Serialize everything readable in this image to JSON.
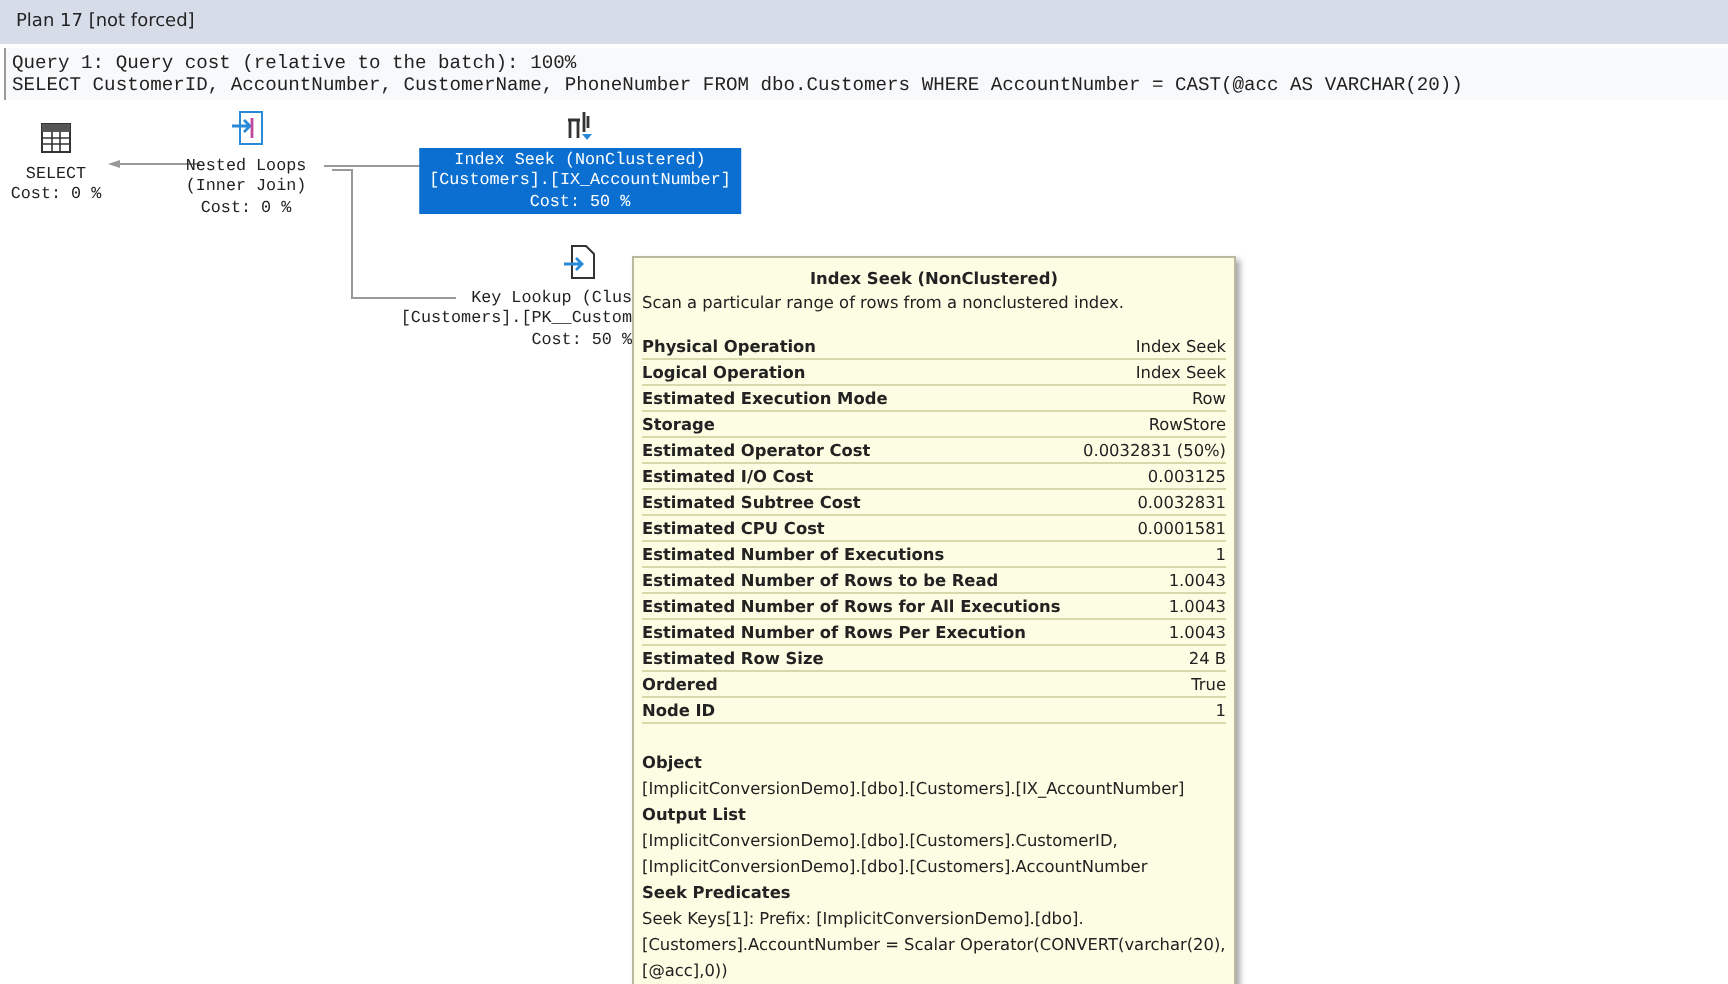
{
  "plan_title": "Plan 17 [not forced]",
  "query": {
    "header": "Query 1: Query cost (relative to the batch): 100%",
    "sql": "SELECT CustomerID, AccountNumber, CustomerName, PhoneNumber FROM dbo.Customers WHERE AccountNumber = CAST(@acc AS VARCHAR(20))"
  },
  "nodes": [
    {
      "kind": "select",
      "lines": [
        "SELECT",
        "Cost: 0 %"
      ],
      "selected": false
    },
    {
      "kind": "nested-loops",
      "lines": [
        "Nested Loops",
        "(Inner Join)",
        "Cost: 0 %"
      ],
      "selected": false
    },
    {
      "kind": "index-seek",
      "lines": [
        "Index Seek (NonClustered)",
        "[Customers].[IX_AccountNumber]",
        "Cost: 50 %"
      ],
      "selected": true
    },
    {
      "kind": "key-lookup",
      "lines": [
        "Key Lookup (Clus",
        "[Customers].[PK__Custom",
        "Cost: 50 %"
      ],
      "selected": false
    }
  ],
  "tooltip": {
    "title": "Index Seek (NonClustered)",
    "description": "Scan a particular range of rows from a nonclustered index.",
    "properties": [
      {
        "name": "Physical Operation",
        "value": "Index Seek"
      },
      {
        "name": "Logical Operation",
        "value": "Index Seek"
      },
      {
        "name": "Estimated Execution Mode",
        "value": "Row"
      },
      {
        "name": "Storage",
        "value": "RowStore"
      },
      {
        "name": "Estimated Operator Cost",
        "value": "0.0032831 (50%)"
      },
      {
        "name": "Estimated I/O Cost",
        "value": "0.003125"
      },
      {
        "name": "Estimated Subtree Cost",
        "value": "0.0032831"
      },
      {
        "name": "Estimated CPU Cost",
        "value": "0.0001581"
      },
      {
        "name": "Estimated Number of Executions",
        "value": "1"
      },
      {
        "name": "Estimated Number of Rows to be Read",
        "value": "1.0043"
      },
      {
        "name": "Estimated Number of Rows for All Executions",
        "value": "1.0043"
      },
      {
        "name": "Estimated Number of Rows Per Execution",
        "value": "1.0043"
      },
      {
        "name": "Estimated Row Size",
        "value": "24 B"
      },
      {
        "name": "Ordered",
        "value": "True"
      },
      {
        "name": "Node ID",
        "value": "1"
      }
    ],
    "sections": [
      {
        "heading": "Object",
        "text": "[ImplicitConversionDemo].[dbo].[Customers].[IX_AccountNumber]"
      },
      {
        "heading": "Output List",
        "text": "[ImplicitConversionDemo].[dbo].[Customers].CustomerID, [ImplicitConversionDemo].[dbo].[Customers].AccountNumber"
      },
      {
        "heading": "Seek Predicates",
        "text": "Seek Keys[1]: Prefix: [ImplicitConversionDemo].[dbo].[Customers].AccountNumber = Scalar Operator(CONVERT(varchar(20),[@acc],0))"
      }
    ]
  }
}
